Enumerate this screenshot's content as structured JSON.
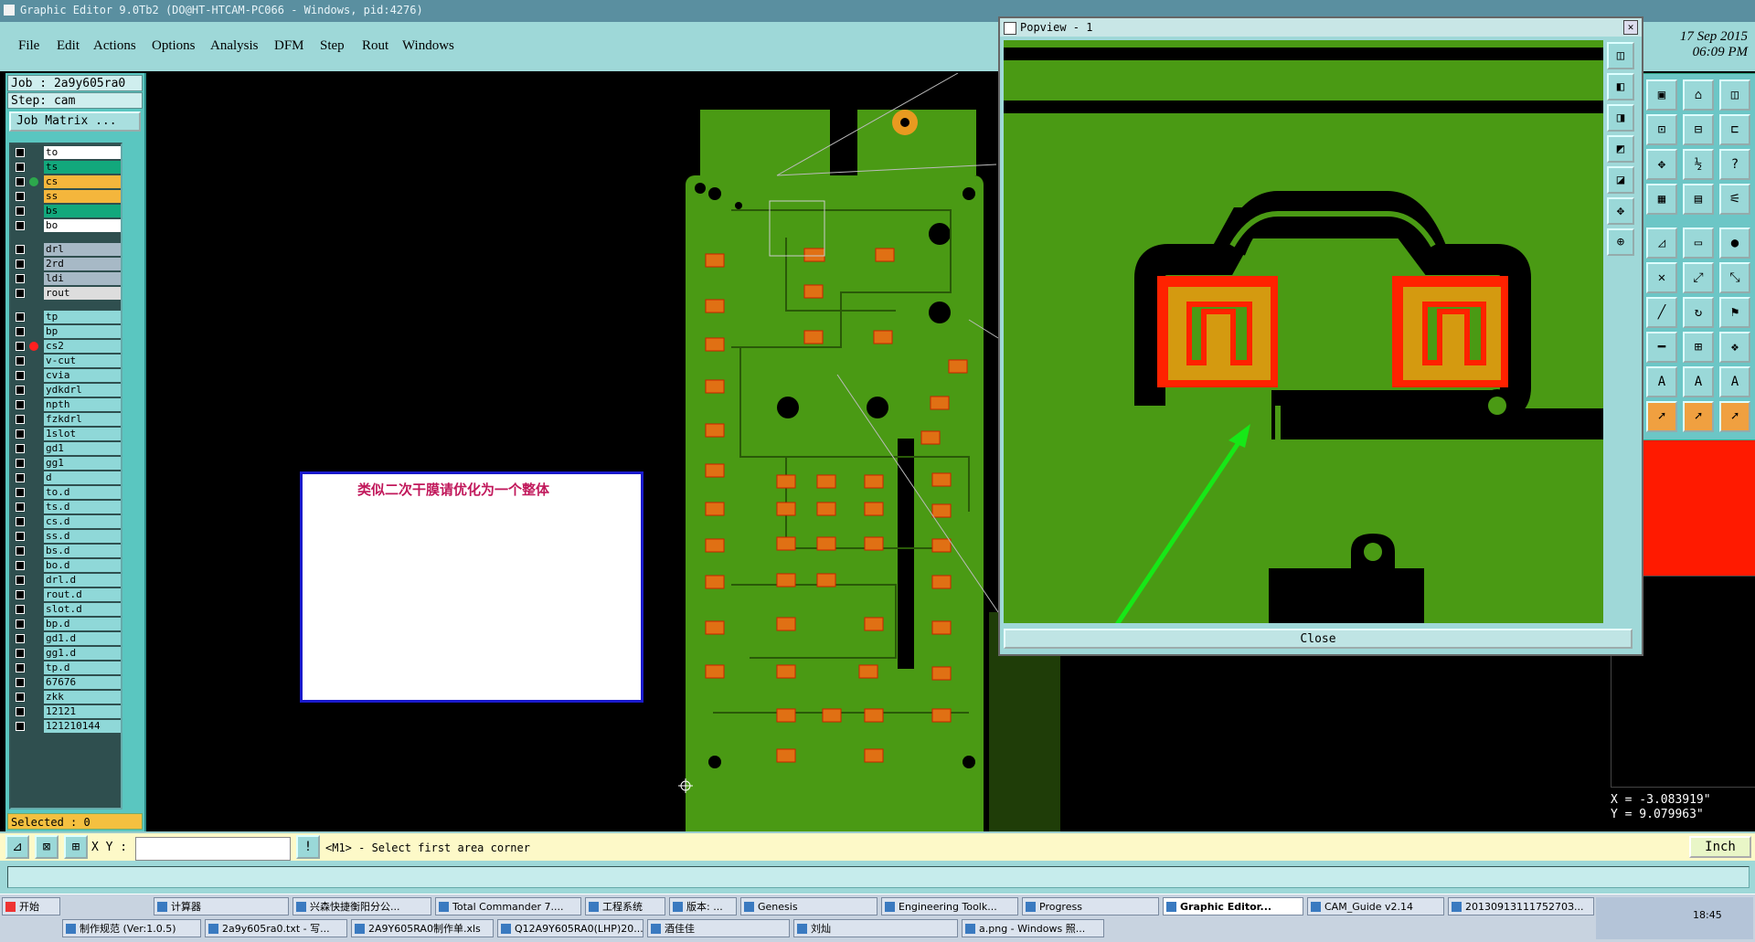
{
  "window": {
    "title": "Graphic Editor 9.0Tb2 (DO@HT-HTCAM-PC066 - Windows, pid:4276)"
  },
  "menu": [
    "File",
    "Edit",
    "Actions",
    "Options",
    "Analysis",
    "DFM",
    "Step",
    "Rout",
    "Windows"
  ],
  "clock": {
    "date": "17 Sep 2015",
    "time": "06:09 PM"
  },
  "job": {
    "job": "Job : 2a9y605ra0",
    "step": "Step: cam",
    "matrix_button": "Job Matrix ..."
  },
  "layers": [
    {
      "name": "to",
      "color": "#ffffff"
    },
    {
      "name": "ts",
      "color": "#12a87c"
    },
    {
      "name": "cs",
      "color": "#f4b63c",
      "active": true
    },
    {
      "name": "ss",
      "color": "#f4b63c"
    },
    {
      "name": "bs",
      "color": "#12a87c"
    },
    {
      "name": "bo",
      "color": "#ffffff"
    },
    {
      "name": "drl",
      "color": "#a7b9c6"
    },
    {
      "name": "2rd",
      "color": "#a7b9c6"
    },
    {
      "name": "ldi",
      "color": "#a7b9c6"
    },
    {
      "name": "rout",
      "color": "#dddddd"
    },
    {
      "name": "tp",
      "color": "#8fd8d8"
    },
    {
      "name": "bp",
      "color": "#8fd8d8"
    },
    {
      "name": "cs2",
      "color": "#8fd8d8",
      "work": true
    },
    {
      "name": "v-cut",
      "color": "#8fd8d8"
    },
    {
      "name": "cvia",
      "color": "#8fd8d8"
    },
    {
      "name": "ydkdrl",
      "color": "#8fd8d8"
    },
    {
      "name": "npth",
      "color": "#8fd8d8"
    },
    {
      "name": "fzkdrl",
      "color": "#8fd8d8"
    },
    {
      "name": "1slot",
      "color": "#8fd8d8"
    },
    {
      "name": "gd1",
      "color": "#8fd8d8"
    },
    {
      "name": "gg1",
      "color": "#8fd8d8"
    },
    {
      "name": "d",
      "color": "#8fd8d8"
    },
    {
      "name": "to.d",
      "color": "#8fd8d8"
    },
    {
      "name": "ts.d",
      "color": "#8fd8d8"
    },
    {
      "name": "cs.d",
      "color": "#8fd8d8"
    },
    {
      "name": "ss.d",
      "color": "#8fd8d8"
    },
    {
      "name": "bs.d",
      "color": "#8fd8d8"
    },
    {
      "name": "bo.d",
      "color": "#8fd8d8"
    },
    {
      "name": "drl.d",
      "color": "#8fd8d8"
    },
    {
      "name": "rout.d",
      "color": "#8fd8d8"
    },
    {
      "name": "slot.d",
      "color": "#8fd8d8"
    },
    {
      "name": "bp.d",
      "color": "#8fd8d8"
    },
    {
      "name": "gd1.d",
      "color": "#8fd8d8"
    },
    {
      "name": "gg1.d",
      "color": "#8fd8d8"
    },
    {
      "name": "tp.d",
      "color": "#8fd8d8"
    },
    {
      "name": "67676",
      "color": "#8fd8d8"
    },
    {
      "name": "zkk",
      "color": "#8fd8d8"
    },
    {
      "name": "12121",
      "color": "#8fd8d8"
    },
    {
      "name": "121210144",
      "color": "#8fd8d8"
    }
  ],
  "selected": "Selected : 0",
  "note": "类似二次干膜请优化为一个整体",
  "popview": {
    "title": "Popview - 1",
    "close": "Close"
  },
  "coords": {
    "x": "X = -3.083919\"",
    "y": "Y = 9.079963\""
  },
  "command": {
    "xy_label": "X Y :",
    "prompt": "<M1> - Select first area corner",
    "units": "Inch"
  },
  "taskbar": {
    "start": "开始",
    "row1": [
      "计算器",
      "兴森快捷衡阳分公...",
      "Total Commander 7....",
      "工程系统",
      "版本: ...",
      "Genesis",
      "Engineering Toolk...",
      "Progress",
      "Graphic Editor...",
      "CAM_Guide v2.14",
      "2013091311175270З..."
    ],
    "row2": [
      "制作规范 (Ver:1.0.5)",
      "2a9y605ra0.txt - 写...",
      "2A9Y605RA0制作单.xls",
      "Q12A9Y605RA0(LHP)20...",
      "酒佳佳",
      "刘灿",
      "a.png - Windows 照..."
    ],
    "time": "18:45"
  },
  "colors": {
    "board": "#4a9a14",
    "copper_pad": "#e07014",
    "highlight": "#ff2200"
  }
}
